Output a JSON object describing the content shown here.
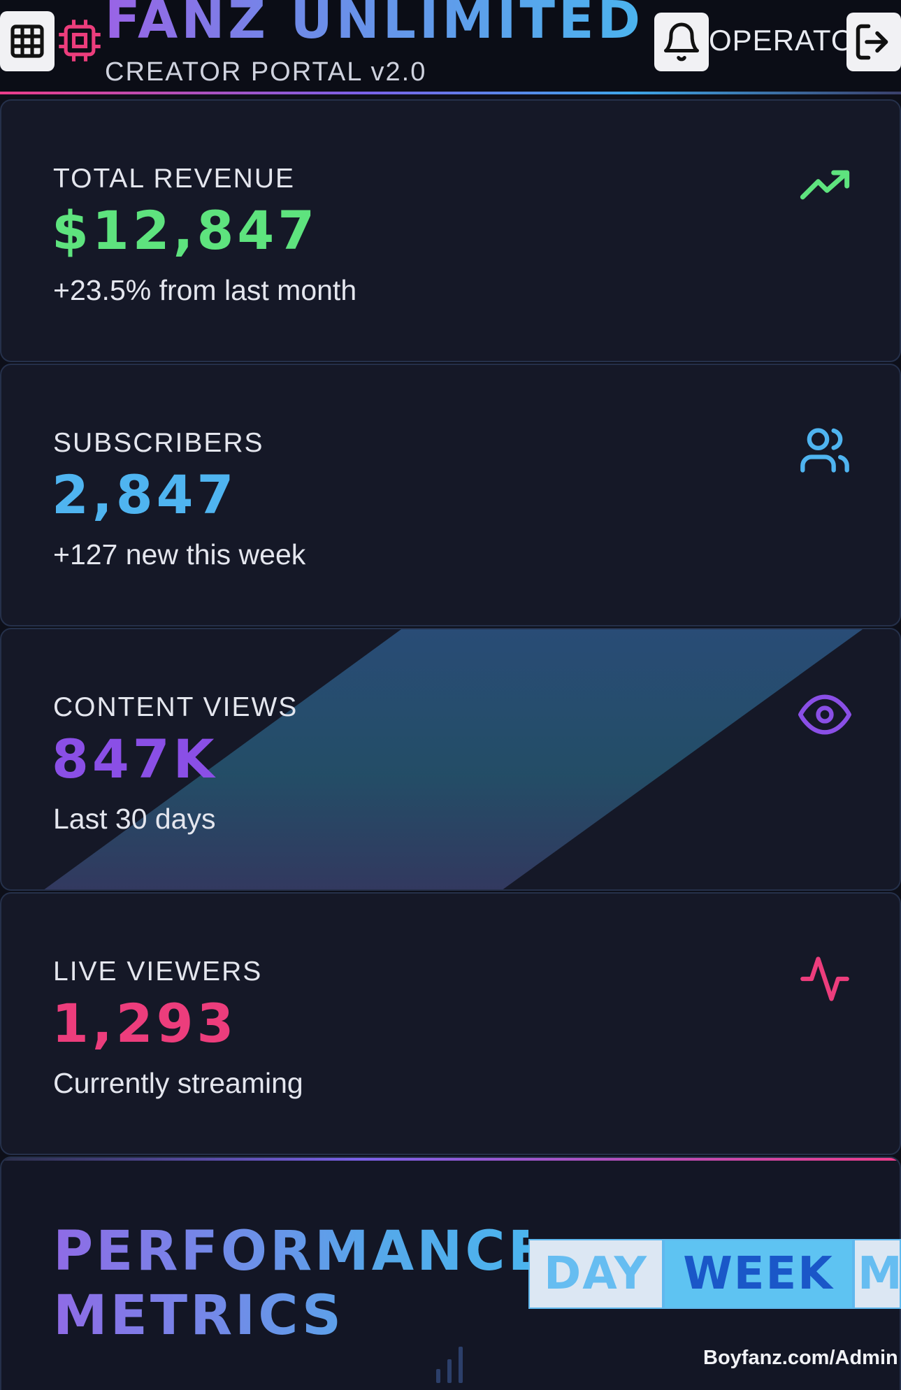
{
  "header": {
    "brand_title": "FANZ UNLIMITED",
    "brand_subtitle": "CREATOR PORTAL v2.0",
    "user_label": "OPERATOR",
    "icons": {
      "menu": "grid-menu-icon",
      "logo": "chip-icon",
      "notifications": "bell-icon",
      "logout": "logout-icon"
    }
  },
  "stats": [
    {
      "label": "TOTAL REVENUE",
      "value": "$12,847",
      "note": "+23.5% from last month",
      "icon": "trending-up-icon",
      "color": "#5ee37e"
    },
    {
      "label": "SUBSCRIBERS",
      "value": "2,847",
      "note": "+127 new this week",
      "icon": "users-icon",
      "color": "#4fb4f0"
    },
    {
      "label": "CONTENT VIEWS",
      "value": "847K",
      "note": "Last 30 days",
      "icon": "eye-icon",
      "color": "#8a4fe6"
    },
    {
      "label": "LIVE VIEWERS",
      "value": "1,293",
      "note": "Currently streaming",
      "icon": "activity-icon",
      "color": "#ec3d7c"
    }
  ],
  "performance": {
    "title": "PERFORMANCE METRICS",
    "ranges": [
      "DAY",
      "WEEK",
      "M"
    ],
    "selected_range": "WEEK"
  },
  "watermark": "Boyfanz.com/Admin",
  "colors": {
    "background": "#0d0f19",
    "card": "#151827",
    "accent_pink": "#ec3d8a",
    "accent_blue": "#4bb4ee",
    "accent_purple": "#8a4fe6"
  }
}
